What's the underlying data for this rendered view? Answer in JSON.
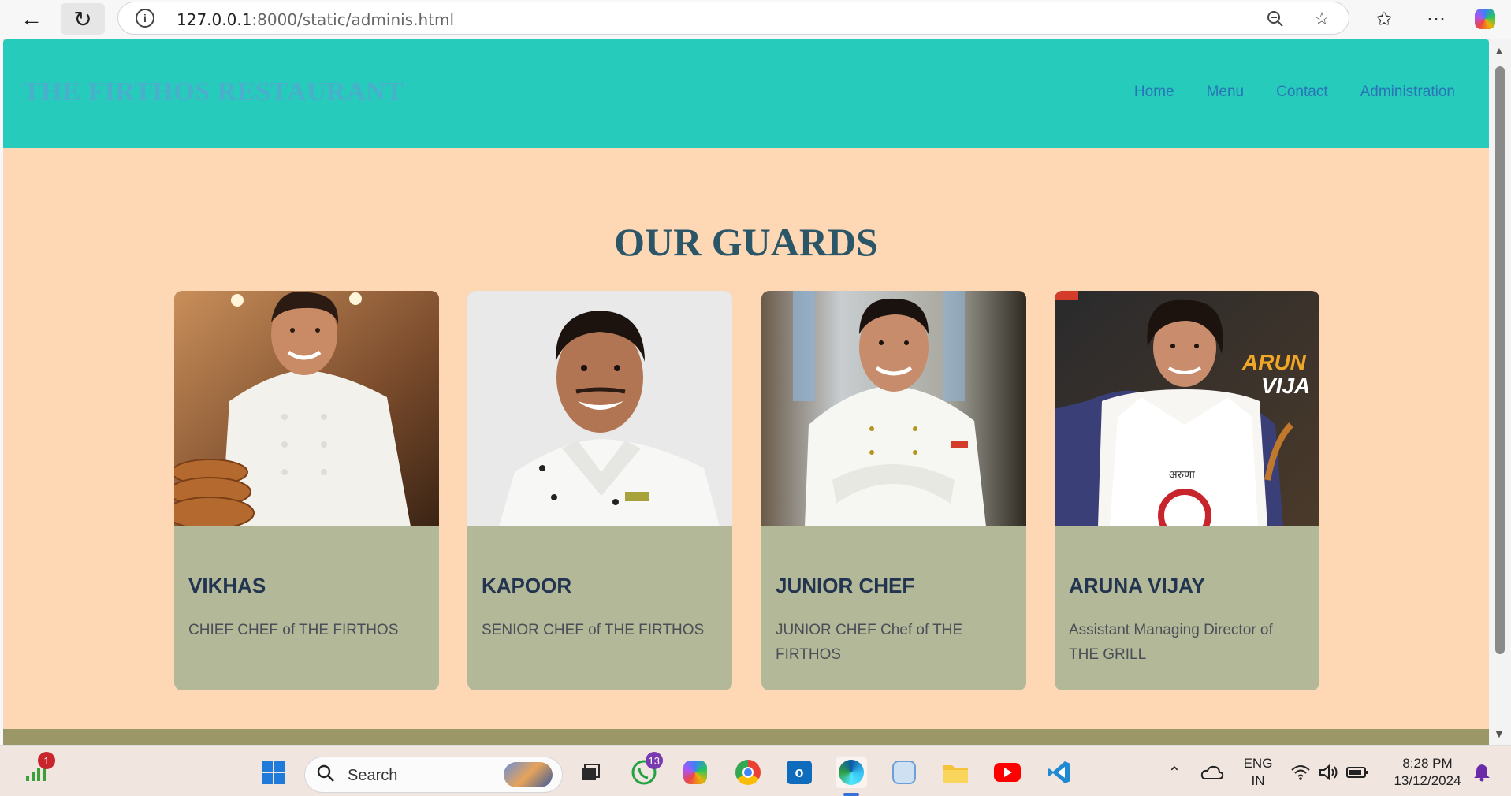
{
  "browser": {
    "url_host": "127.0.0.1",
    "url_rest": ":8000/static/adminis.html"
  },
  "site": {
    "title": "THE FIRTHOS RESTAURANT",
    "nav": [
      {
        "label": "Home"
      },
      {
        "label": "Menu"
      },
      {
        "label": "Contact"
      },
      {
        "label": "Administration"
      }
    ]
  },
  "section": {
    "title": "OUR GUARDS"
  },
  "cards": [
    {
      "name": "VIKHAS",
      "role": "CHIEF CHEF of THE FIRTHOS"
    },
    {
      "name": "KAPOOR",
      "role": "SENIOR CHEF of THE FIRTHOS"
    },
    {
      "name": "JUNIOR CHEF",
      "role": "JUNIOR CHEF Chef of THE FIRTHOS"
    },
    {
      "name": "ARUNA VIJAY",
      "role": "Assistant Managing Director of THE GRILL"
    }
  ],
  "photo_text": {
    "aruna_banner_line1": "ARUN",
    "aruna_banner_line2": "VIJA",
    "aruna_apron": "अरुणा"
  },
  "taskbar": {
    "search_label": "Search",
    "badges": {
      "network": "1",
      "whatsapp": "13"
    },
    "lang_line1": "ENG",
    "lang_line2": "IN",
    "time": "8:28 PM",
    "date": "13/12/2024"
  },
  "colors": {
    "header_bg": "#26cbbb",
    "page_bg": "#fed7b5",
    "card_bg": "#b3b998",
    "title_color": "#2a5668",
    "nav_link": "#2a73b6"
  }
}
